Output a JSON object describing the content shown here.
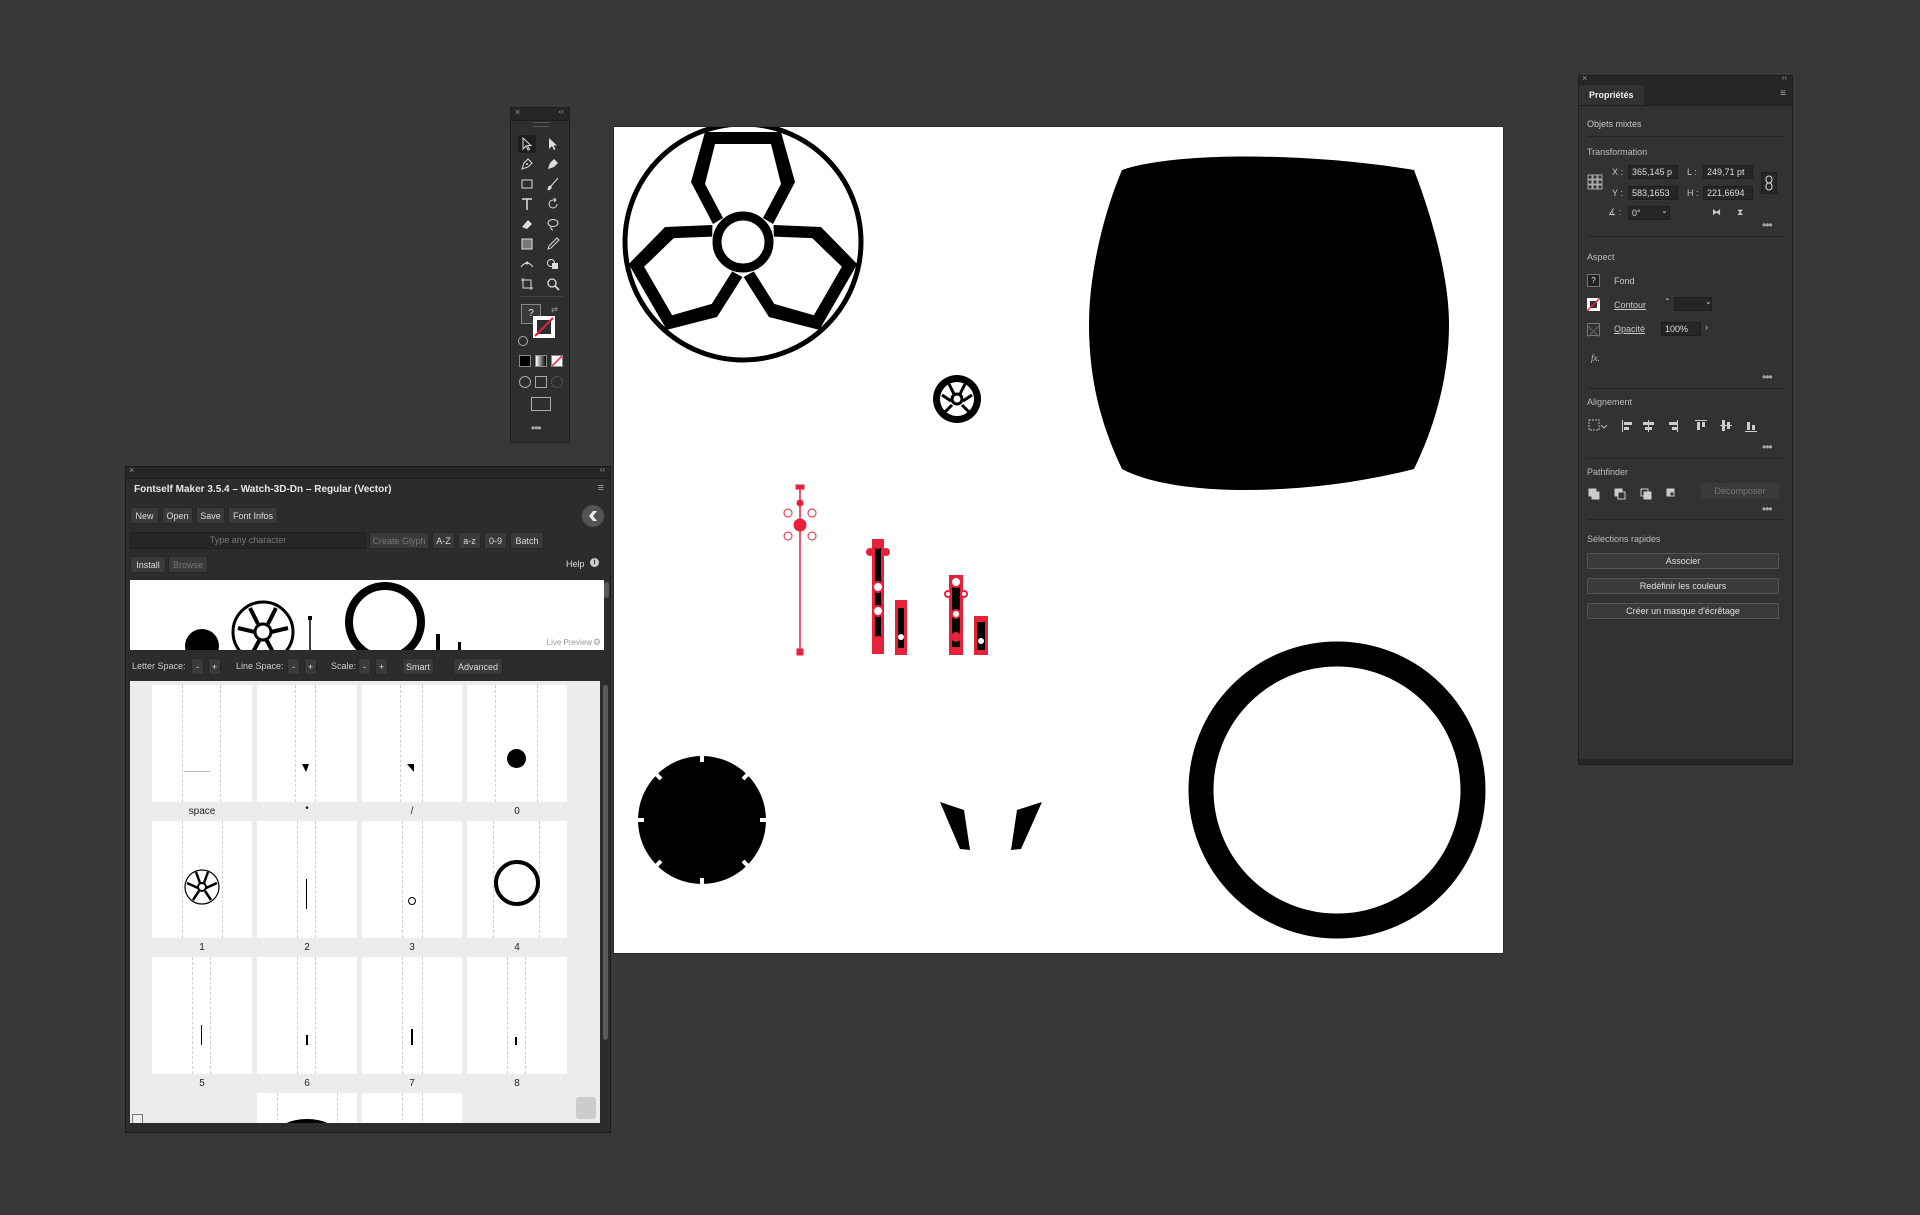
{
  "fontself": {
    "title": "Fontself Maker 3.5.4 – Watch-3D-Dn – Regular (Vector)",
    "buttons": {
      "new": "New",
      "open": "Open",
      "save": "Save",
      "font_infos": "Font Infos"
    },
    "glyph_input_placeholder": "Type any character",
    "create_glyph": "Create Glyph",
    "batch_filters": [
      "A-Z",
      "a-z",
      "0-9",
      "Batch"
    ],
    "tabs": {
      "install": "Install",
      "browse": "Browse"
    },
    "help": "Help",
    "live_preview": "Live Preview",
    "spacing": {
      "letter_space": "Letter Space:",
      "line_space": "Line Space:",
      "scale": "Scale:",
      "minus": "-",
      "plus": "+",
      "smart": "Smart",
      "advanced": "Advanced"
    },
    "glyph_labels": [
      "space",
      "•",
      "/",
      "0",
      "1",
      "2",
      "3",
      "4",
      "5",
      "6",
      "7",
      "8"
    ]
  },
  "properties": {
    "tab": "Propriétés",
    "selection": "Objets mixtes",
    "transformation": {
      "title": "Transformation",
      "x_label": "X :",
      "x": "365,145 p",
      "y_label": "Y :",
      "y": "583,1653",
      "l_label": "L :",
      "l": "249,71 pt",
      "h_label": "H :",
      "h": "221,6694",
      "angle": "0°"
    },
    "aspect": {
      "title": "Aspect",
      "fond": "Fond",
      "contour": "Contour",
      "opacite": "Opacité",
      "opacity_value": "100%",
      "fx": "fx."
    },
    "alignement": "Alignement",
    "pathfinder": {
      "title": "Pathfinder",
      "decomposer": "Décomposer"
    },
    "quick_actions": {
      "title": "Sélections rapides",
      "associer": "Associer",
      "redefinir": "Redéfinir les couleurs",
      "masque": "Créer un masque d'écrêtage"
    }
  },
  "tools": {
    "icons": [
      "selection-tool-icon",
      "direct-selection-tool-icon",
      "pen-tool-icon",
      "curvature-tool-icon",
      "rectangle-tool-icon",
      "paintbrush-tool-icon",
      "type-tool-icon",
      "rotate-tool-icon",
      "eraser-tool-icon",
      "lasso-tool-icon",
      "gradient-tool-icon",
      "eyedropper-tool-icon",
      "width-tool-icon",
      "shape-builder-icon",
      "artboard-tool-icon",
      "zoom-tool-icon"
    ],
    "fill_stroke_label": "?"
  },
  "colors": {
    "accent_red": "#e8213b",
    "canvas": "#ffffff",
    "ui_bg": "#383838"
  }
}
